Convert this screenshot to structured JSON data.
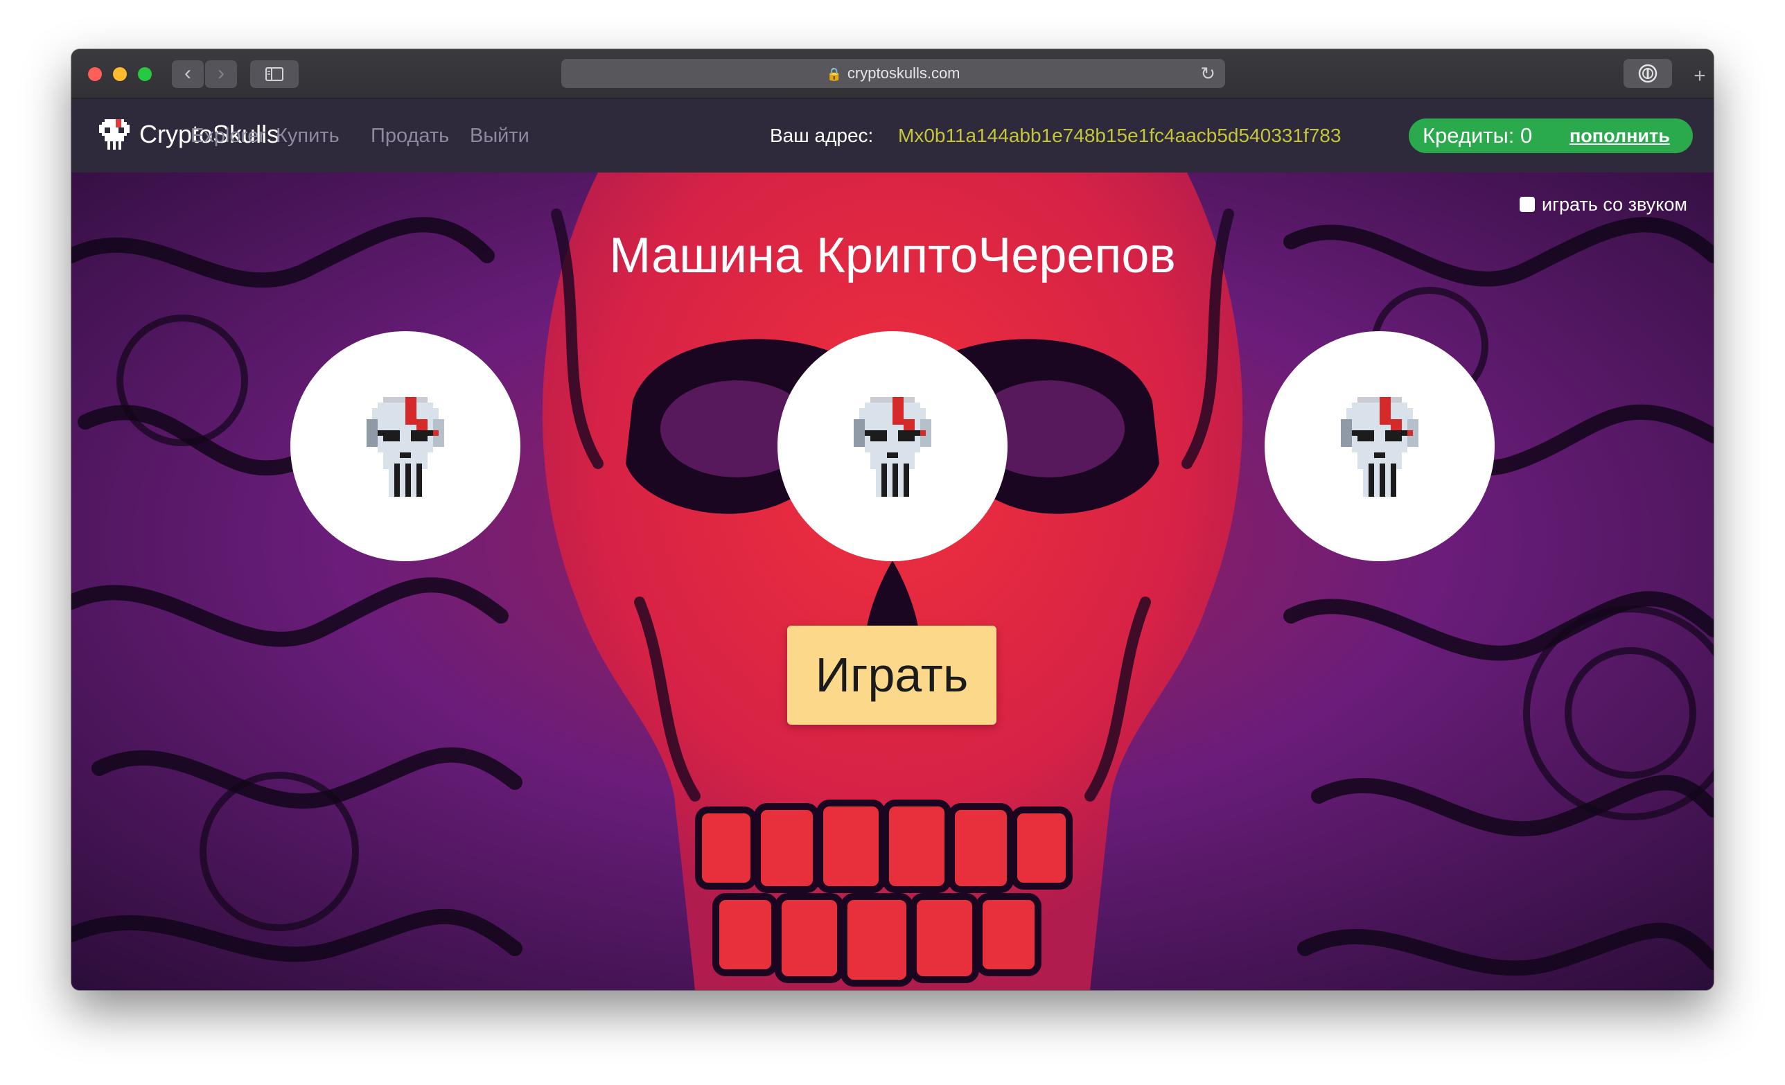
{
  "browser": {
    "url": "cryptoskulls.com"
  },
  "navbar": {
    "brand": "CryptoSkulls",
    "links": [
      "Explorer",
      "Купить",
      "Продать",
      "Выйти"
    ],
    "address_label": "Ваш адрес:",
    "address_value": "Mx0b11a144abb1e748b15e1fc4aacb5d540331f783",
    "credits_label": "Кредиты: 0",
    "credits_link": "пополнить"
  },
  "game": {
    "sound_label": "играть со звуком",
    "sound_checked": false,
    "title": "Машина КриптоЧерепов",
    "reels": [
      "pixel-skull-icon",
      "pixel-skull-icon",
      "pixel-skull-icon"
    ],
    "play_label": "Играть"
  },
  "colors": {
    "navbar_bg": "#2e2a3b",
    "address": "#c4c53a",
    "credits_bg": "#2aaa4d",
    "play_button": "#fcd98a",
    "background_red": "#e0263a",
    "background_purple": "#6a1d7a"
  }
}
